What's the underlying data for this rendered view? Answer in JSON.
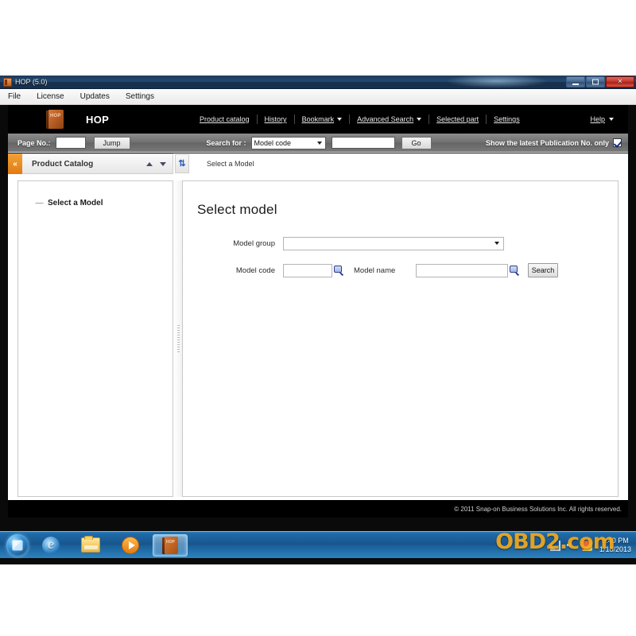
{
  "window": {
    "title": "HOP (5.0)",
    "icon": "hop-book-icon",
    "minimize_label": "",
    "maximize_label": "",
    "close_label": "✕"
  },
  "menubar": {
    "items": [
      {
        "label": "File"
      },
      {
        "label": "License"
      },
      {
        "label": "Updates"
      },
      {
        "label": "Settings"
      }
    ]
  },
  "appheader": {
    "logo_text": "HOP",
    "brand": "HOP",
    "nav": [
      {
        "label": "Product catalog",
        "has_caret": false
      },
      {
        "label": "History",
        "has_caret": false
      },
      {
        "label": "Bookmark",
        "has_caret": true
      },
      {
        "label": "Advanced Search",
        "has_caret": true
      },
      {
        "label": "Selected part",
        "has_caret": false
      },
      {
        "label": "Settings",
        "has_caret": false
      }
    ],
    "help_label": "Help"
  },
  "toolbar": {
    "page_no_label": "Page No.:",
    "page_no_value": "",
    "jump_label": "Jump",
    "search_for_label": "Search for :",
    "search_for_value": "Model code",
    "search_for_options": [
      "Model code"
    ],
    "search_value": "",
    "go_label": "Go",
    "latest_pub_label": "Show the latest Publication No. only",
    "latest_pub_checked": "true"
  },
  "subheader": {
    "collapse_label": "«",
    "catalog_title": "Product Catalog",
    "up_icon": "triangle-up-icon",
    "down_icon": "triangle-down-icon",
    "refresh_icon": "⇅",
    "breadcrumb": "Select a Model"
  },
  "tree": {
    "expander": "—",
    "root_label": "Select a Model"
  },
  "main": {
    "heading": "Select model",
    "fields": {
      "model_group_label": "Model group",
      "model_group_value": "",
      "model_code_label": "Model code",
      "model_code_value": "",
      "model_name_label": "Model name",
      "model_name_value": "",
      "search_label": "Search",
      "lookup_icon": "magnifier-icon"
    }
  },
  "footer": {
    "copyright": "© 2011 Snap-on Business Solutions Inc. All rights reserved."
  },
  "taskbar": {
    "start_label": "Start",
    "tasks": [
      {
        "name": "internet-explorer",
        "label": "Internet Explorer"
      },
      {
        "name": "windows-explorer",
        "label": "Windows Explorer"
      },
      {
        "name": "media-player",
        "label": "Windows Media Player"
      },
      {
        "name": "hop-app",
        "label": "HOP",
        "active": "true"
      }
    ],
    "clock_time": "3:40 PM",
    "clock_date": "1/18/2013"
  },
  "watermark": {
    "text": "OBD2.com"
  },
  "colors": {
    "accent_orange": "#e07b12",
    "header_black": "#000000",
    "toolbar_gray": "#6f6f6f",
    "taskbar_blue": "#17558c",
    "watermark_gold": "#f2a81c"
  }
}
